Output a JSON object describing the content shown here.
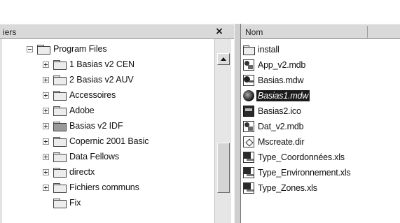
{
  "folder_pane": {
    "title": "iers",
    "close_label": "×"
  },
  "tree": {
    "root": {
      "label": "Program Files",
      "expanded": true
    },
    "children": [
      {
        "label": "1 Basias v2 CEN",
        "has_children": true
      },
      {
        "label": "2 Basias v2 AUV",
        "has_children": true
      },
      {
        "label": "Accessoires",
        "has_children": true
      },
      {
        "label": "Adobe",
        "has_children": true
      },
      {
        "label": "Basias v2 IDF",
        "has_children": true
      },
      {
        "label": "Copernic 2001 Basic",
        "has_children": true
      },
      {
        "label": "Data Fellows",
        "has_children": true
      },
      {
        "label": "directx",
        "has_children": true
      },
      {
        "label": "Fichiers communs",
        "has_children": true
      },
      {
        "label": "Fix",
        "has_children": false
      }
    ]
  },
  "file_pane": {
    "column_name": "Nom",
    "files": [
      {
        "label": "install",
        "icon": "folder-icon"
      },
      {
        "label": "App_v2.mdb",
        "icon": "database-icon"
      },
      {
        "label": "Basias.mdw",
        "icon": "key-icon"
      },
      {
        "label": "Basias1.mdw",
        "icon": "globe-icon",
        "selected": true
      },
      {
        "label": "Basias2.ico",
        "icon": "image-icon"
      },
      {
        "label": "Dat_v2.mdb",
        "icon": "database-icon"
      },
      {
        "label": "Mscreate.dir",
        "icon": "dir-file-icon"
      },
      {
        "label": "Type_Coordonnées.xls",
        "icon": "excel-icon"
      },
      {
        "label": "Type_Environnement.xls",
        "icon": "excel-icon"
      },
      {
        "label": "Type_Zones.xls",
        "icon": "excel-icon"
      }
    ]
  }
}
